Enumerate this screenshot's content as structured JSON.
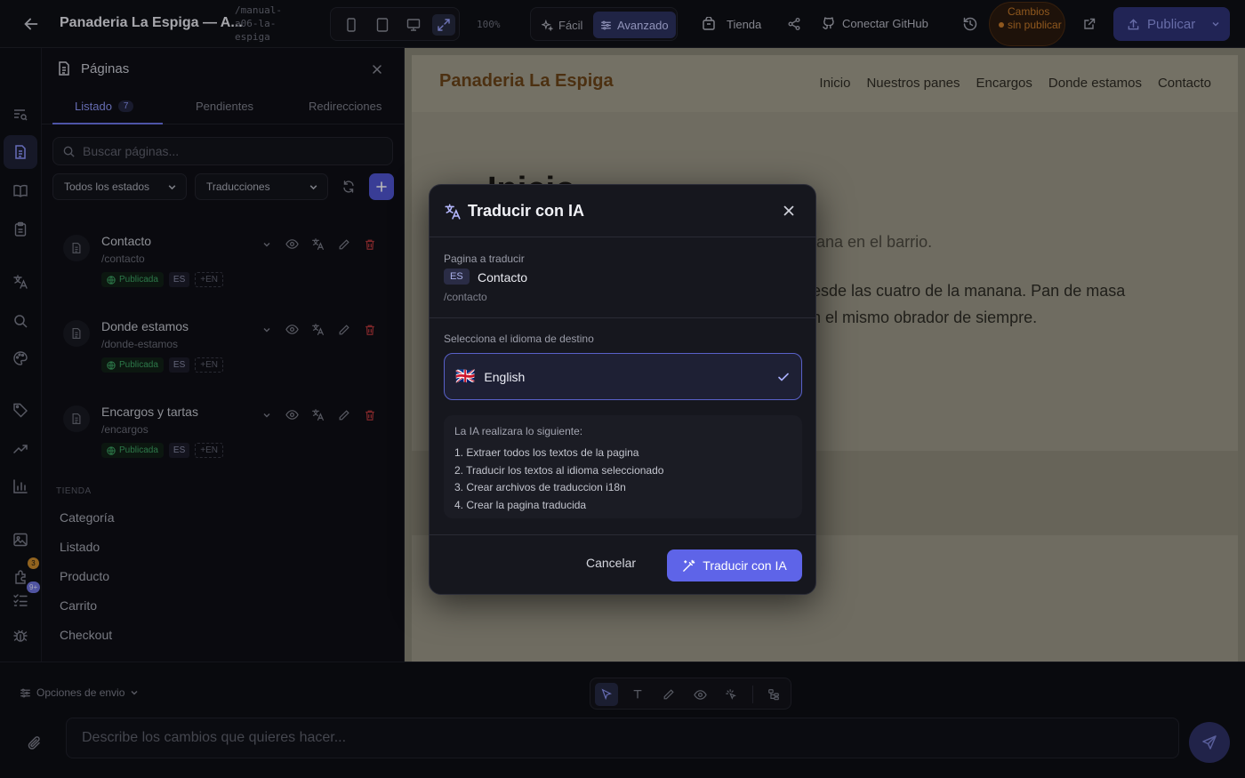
{
  "topbar": {
    "project_title": "Panaderia La Espiga — A...",
    "project_path": "/manual-a06-la-espiga",
    "zoom": "100%",
    "mode_easy": "Fácil",
    "mode_advanced": "Avanzado",
    "shop": "Tienda",
    "github": "Conectar GitHub",
    "unsaved": "Cambios sin publicar",
    "publish": "Publicar"
  },
  "rail": {
    "badge_plugins": "3",
    "badge_more": "9+"
  },
  "panel": {
    "title": "Páginas",
    "tabs": [
      {
        "label": "Listado",
        "count": "7"
      },
      {
        "label": "Pendientes"
      },
      {
        "label": "Redirecciones"
      }
    ],
    "search_placeholder": "Buscar páginas...",
    "filter_status": "Todos los estados",
    "filter_translations": "Traducciones",
    "pages": [
      {
        "title": "Contacto",
        "path": "/contacto",
        "status": "Publicada",
        "lang": "ES",
        "add_lang": "+EN"
      },
      {
        "title": "Donde estamos",
        "path": "/donde-estamos",
        "status": "Publicada",
        "lang": "ES",
        "add_lang": "+EN"
      },
      {
        "title": "Encargos y tartas",
        "path": "/encargos",
        "status": "Publicada",
        "lang": "ES",
        "add_lang": "+EN"
      }
    ],
    "shop_section": "TIENDA",
    "shop_items": [
      "Categoría",
      "Listado",
      "Producto",
      "Carrito",
      "Checkout"
    ]
  },
  "preview": {
    "logo": "Panaderia La Espiga",
    "nav": [
      "Inicio",
      "Nuestros panes",
      "Encargos",
      "Donde estamos",
      "Contacto"
    ],
    "hero_title": "Inicio",
    "hero_sub": "mana en el barrio.",
    "hero_p": "desde las cuatro de la manana. Pan de masa en el mismo obrador de siempre."
  },
  "composer": {
    "send_options": "Opciones de envio",
    "placeholder": "Describe los cambios que quieres hacer..."
  },
  "modal": {
    "title": "Traducir con IA",
    "page_label": "Pagina a traducir",
    "page_lang": "ES",
    "page_name": "Contacto",
    "page_path": "/contacto",
    "target_label": "Selecciona el idioma de destino",
    "target_flag": "🇬🇧",
    "target_language": "English",
    "info_title": "La IA realizara lo siguiente:",
    "steps": [
      "1. Extraer todos los textos de la pagina",
      "2. Traducir los textos al idioma seleccionado",
      "3. Crear archivos de traduccion i18n",
      "4. Crear la pagina traducida"
    ],
    "cancel": "Cancelar",
    "confirm": "Traducir con IA"
  }
}
